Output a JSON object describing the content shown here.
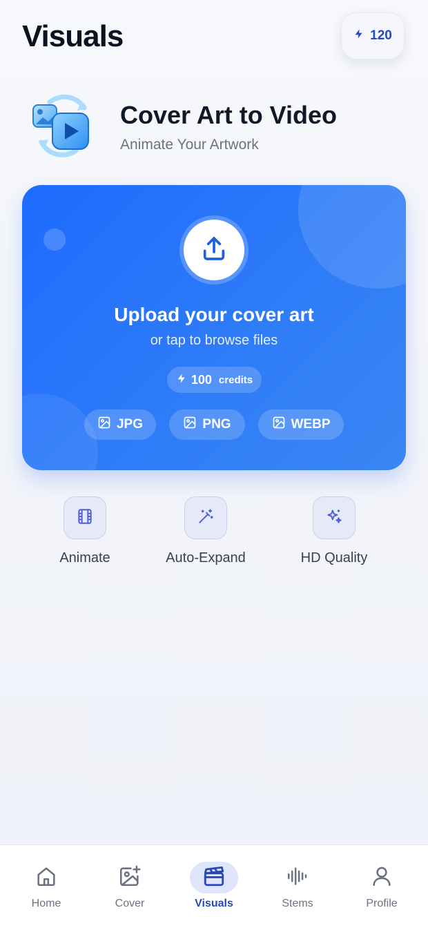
{
  "header": {
    "title": "Visuals",
    "credits": "120",
    "credits_icon": "lightning-icon"
  },
  "hero": {
    "title": "Cover Art to Video",
    "subtitle": "Animate Your Artwork",
    "icon": "image-to-video-icon"
  },
  "upload": {
    "title": "Upload your cover art",
    "hint": "or tap to browse files",
    "cost_value": "100",
    "cost_unit": "credits",
    "formats": [
      "JPG",
      "PNG",
      "WEBP"
    ]
  },
  "features": [
    {
      "label": "Animate",
      "icon": "film-icon"
    },
    {
      "label": "Auto-Expand",
      "icon": "magic-wand-icon"
    },
    {
      "label": "HD Quality",
      "icon": "sparkles-icon"
    }
  ],
  "nav": {
    "active": "Visuals",
    "items": [
      {
        "label": "Home",
        "icon": "home-icon"
      },
      {
        "label": "Cover",
        "icon": "image-plus-icon"
      },
      {
        "label": "Visuals",
        "icon": "clapperboard-icon"
      },
      {
        "label": "Stems",
        "icon": "waveform-icon"
      },
      {
        "label": "Profile",
        "icon": "user-icon"
      }
    ]
  },
  "colors": {
    "accent": "#2948b8",
    "card_blue": "#1e6bff",
    "background": "#f4f6fb"
  }
}
